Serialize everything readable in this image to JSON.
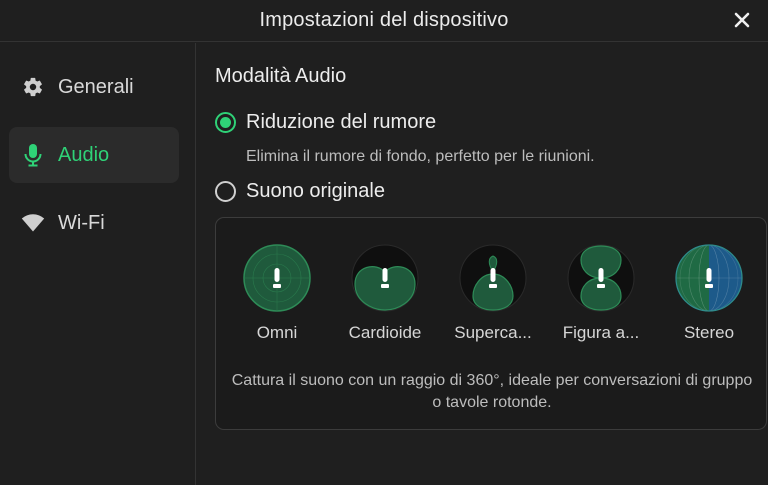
{
  "window": {
    "title": "Impostazioni del dispositivo",
    "close_icon": "close-icon"
  },
  "sidebar": {
    "items": [
      {
        "label": "Generali",
        "icon": "gear-icon",
        "active": false
      },
      {
        "label": "Audio",
        "icon": "microphone-icon",
        "active": true
      },
      {
        "label": "Wi-Fi",
        "icon": "wifi-icon",
        "active": false
      }
    ]
  },
  "audio": {
    "section_title": "Modalità Audio",
    "options": [
      {
        "label": "Riduzione del rumore",
        "selected": true,
        "description": "Elimina il rumore di fondo, perfetto per le riunioni."
      },
      {
        "label": "Suono originale",
        "selected": false
      }
    ],
    "patterns": [
      {
        "label": "Omni",
        "icon": "omni-pattern-icon"
      },
      {
        "label": "Cardioide",
        "icon": "cardioid-pattern-icon"
      },
      {
        "label": "Superca...",
        "icon": "supercardioid-pattern-icon"
      },
      {
        "label": "Figura a...",
        "icon": "figure-eight-pattern-icon"
      },
      {
        "label": "Stereo",
        "icon": "stereo-pattern-icon"
      }
    ],
    "pattern_description": "Cattura il suono con un raggio di 360°, ideale per conversazioni di gruppo o tavole rotonde."
  },
  "colors": {
    "accent": "#2fd277",
    "background": "#1f1f1f",
    "pattern_fill": "#1e5a3a",
    "stereo_blue": "#1d5a8a"
  }
}
